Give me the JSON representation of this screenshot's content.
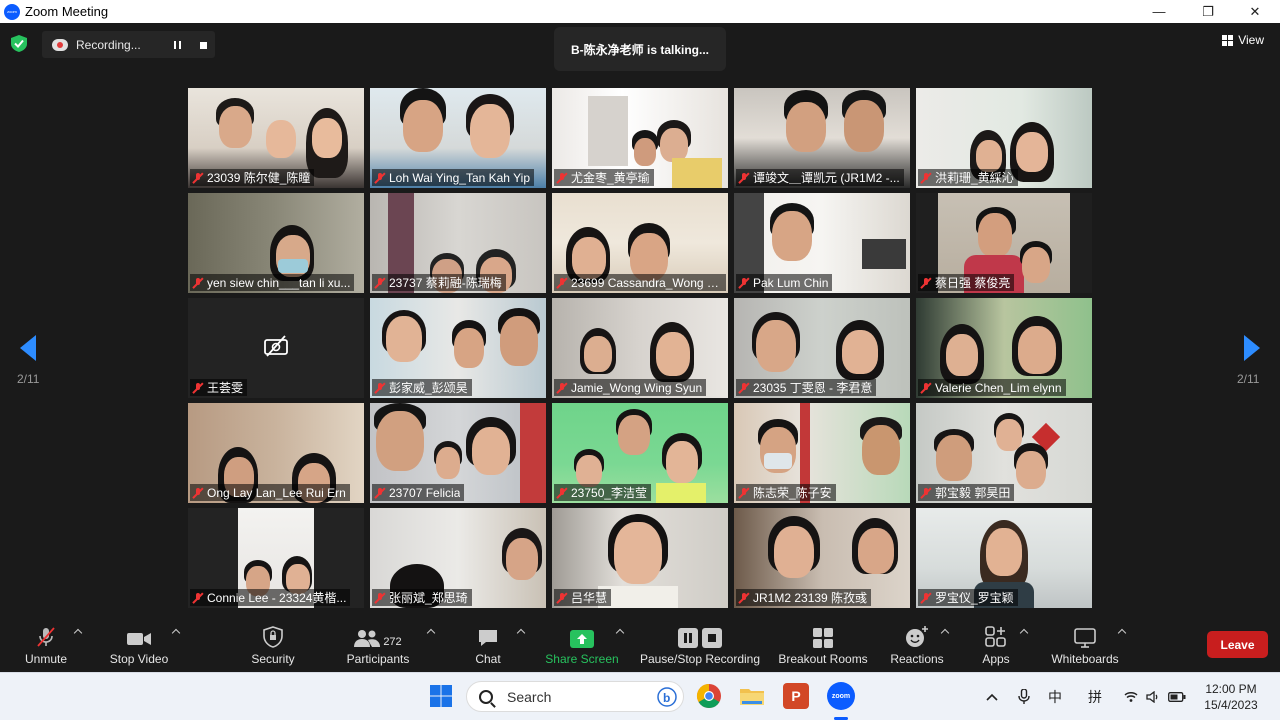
{
  "window": {
    "title": "Zoom Meeting",
    "minimize": "—",
    "restore": "❐",
    "close": "✕"
  },
  "recording": {
    "label": "Recording..."
  },
  "talking": "B-陈永净老师 is talking...",
  "view": {
    "label": "View"
  },
  "pagination": {
    "left": "2/11",
    "right": "2/11"
  },
  "participants": [
    "23039 陈尔健_陈瞳",
    "Loh Wai Ying_Tan Kah Yip",
    "尤金枣_黄亭瑜",
    "谭竣文＿谭凯元 (JR1M2 -...",
    "洪莉珊_黄綵沁",
    "yen siew chin___tan li xu...",
    "23737 蔡莉融-陈瑞梅",
    "23699 Cassandra_Wong J...",
    "Pak Lum Chin",
    "蔡日强 蔡俊亮",
    "王荟雯",
    "彭家威_彭颂昊",
    "Jamie_Wong Wing Syun",
    "23035 丁雯恩 - 李君意",
    "Valerie Chen_Lim elynn",
    "Ong Lay Lan_Lee Rui Ern",
    "23707 Felicia",
    "23750_李洁莹",
    "陈志荣_陈子安",
    "郭宝毅 郭昊田",
    "Connie Lee - 23324黄楷...",
    "张丽斌_郑思琦",
    "吕华慧",
    "JR1M2 23139 陈孜彧",
    "罗宝仪_罗宝颖"
  ],
  "toolbar": {
    "unmute": "Unmute",
    "stop_video": "Stop Video",
    "security": "Security",
    "participants": "Participants",
    "participant_count": "272",
    "chat": "Chat",
    "share_screen": "Share Screen",
    "recording": "Pause/Stop Recording",
    "breakout": "Breakout Rooms",
    "reactions": "Reactions",
    "apps": "Apps",
    "whiteboards": "Whiteboards",
    "leave": "Leave"
  },
  "taskbar": {
    "search": "Search",
    "ime_lang": "中",
    "ime_mode": "拼",
    "time": "12:00 PM",
    "date": "15/4/2023",
    "zoom_label": "zoom",
    "ppt_label": "P"
  },
  "colors": {
    "accent": "#2d8cff",
    "leave": "#c81e1e",
    "share": "#27c25e"
  }
}
